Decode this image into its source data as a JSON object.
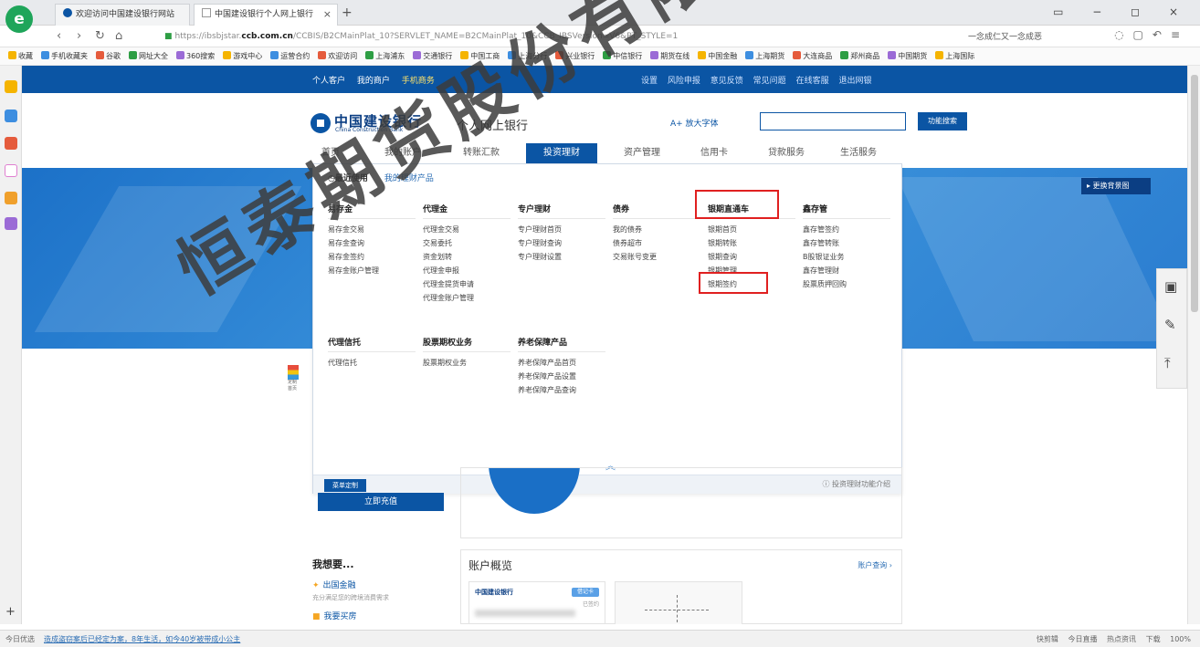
{
  "browser": {
    "tabs": [
      {
        "title": "欢迎访问中国建设银行网站",
        "active": false
      },
      {
        "title": "中国建设银行个人网上银行",
        "active": true
      }
    ],
    "new_tab": "+",
    "window_controls": "▭ − ◻ ×",
    "url_prefix": "https://ibsbjstar.",
    "url_domain": "ccb.com.cn",
    "url_rest": "/CCBIS/B2CMainPlat_10?SERVLET_NAME=B2CMainPlat_10&CCB_IBSVersion=V6&PT_STYLE=1",
    "address_right": "一念成仁又一念成恶",
    "favorites": [
      "收藏",
      "手机收藏夹",
      "谷歌",
      "网址大全",
      "360搜索",
      "游戏中心",
      "运营合约",
      "欢迎访问",
      "上海浦东",
      "交通银行",
      "中国工商",
      "上海分行",
      "兴业银行",
      "中信银行",
      "期货在线",
      "中国金融",
      "上海期货",
      "大连商品",
      "郑州商品",
      "中国期货",
      "上海国际"
    ]
  },
  "top_nav": {
    "left": [
      "个人客户",
      "我的商户",
      "手机商务"
    ],
    "right": [
      "设置",
      "风险申报",
      "意见反馈",
      "常见问题",
      "在线客服",
      "退出网银"
    ]
  },
  "header": {
    "bank_name": "中国建设银行",
    "bank_name_en": "China Construction Bank",
    "site_title": "个人网上银行",
    "enlarge_font": "A+ 放大字体",
    "search_button": "功能搜索",
    "change_background": "▸ 更换背景图"
  },
  "main_nav": [
    "首页",
    "我的账户",
    "转账汇款",
    "投资理财",
    "资产管理",
    "信用卡",
    "贷款服务",
    "生活服务"
  ],
  "main_nav_active": "投资理财",
  "dropdown": {
    "recent": "最近使用",
    "my_products": "我的理财产品",
    "columns": [
      {
        "title": "易存金",
        "items": [
          "易存金交易",
          "易存金查询",
          "易存金签约",
          "易存金账户管理"
        ]
      },
      {
        "title": "代理金",
        "items": [
          "代理金交易",
          "交易委托",
          "资金划转",
          "代理金申报",
          "代理金提货申请",
          "代理金账户管理"
        ]
      },
      {
        "title": "专户理财",
        "items": [
          "专户理财首页",
          "专户理财查询",
          "专户理财设置"
        ]
      },
      {
        "title": "债券",
        "items": [
          "我的债券",
          "债券超市",
          "交易账号变更"
        ]
      },
      {
        "title": "银期直通车",
        "items": [
          "银期首页",
          "银期转账",
          "银期查询",
          "银期管理",
          "银期签约"
        ]
      },
      {
        "title": "鑫存管",
        "items": [
          "鑫存管签约",
          "鑫存管转账",
          "B股银证业务",
          "鑫存管理财",
          "股票质押回购"
        ]
      },
      {
        "title": "代理信托",
        "items": [
          "代理信托"
        ]
      },
      {
        "title": "股票期权业务",
        "items": [
          "股票期权业务"
        ]
      },
      {
        "title": "养老保障产品",
        "items": [
          "养老保障产品首页",
          "养老保障产品设置",
          "养老保障产品查询"
        ]
      }
    ],
    "menu_custom": "菜单定制",
    "intro": "投资理财功能介绍"
  },
  "content": {
    "recharge": "立即充值",
    "want_title": "我想要...",
    "want_items": [
      {
        "label": "出国金融",
        "desc": "充分满足您的跨境消费需求"
      },
      {
        "label": "我要买房",
        "desc": ""
      }
    ],
    "overview_title": "账户概览",
    "overview_link": "账户查询 ›",
    "card_bank": "中国建设银行",
    "card_badge": "借记卡",
    "card_status": "已签约"
  },
  "float_badge": "定制首页",
  "status": {
    "left": "今日优选",
    "news": "造成盗窃案后已经定为案，8年生活，如今40岁被带成小公主",
    "right": [
      "快剪辑",
      "今日直播",
      "热点资讯",
      "下载",
      "100%"
    ]
  },
  "watermark": "恒泰期货股份有限公司",
  "colors": {
    "brand_blue": "#0b55a4",
    "highlight_red": "#e02020"
  }
}
